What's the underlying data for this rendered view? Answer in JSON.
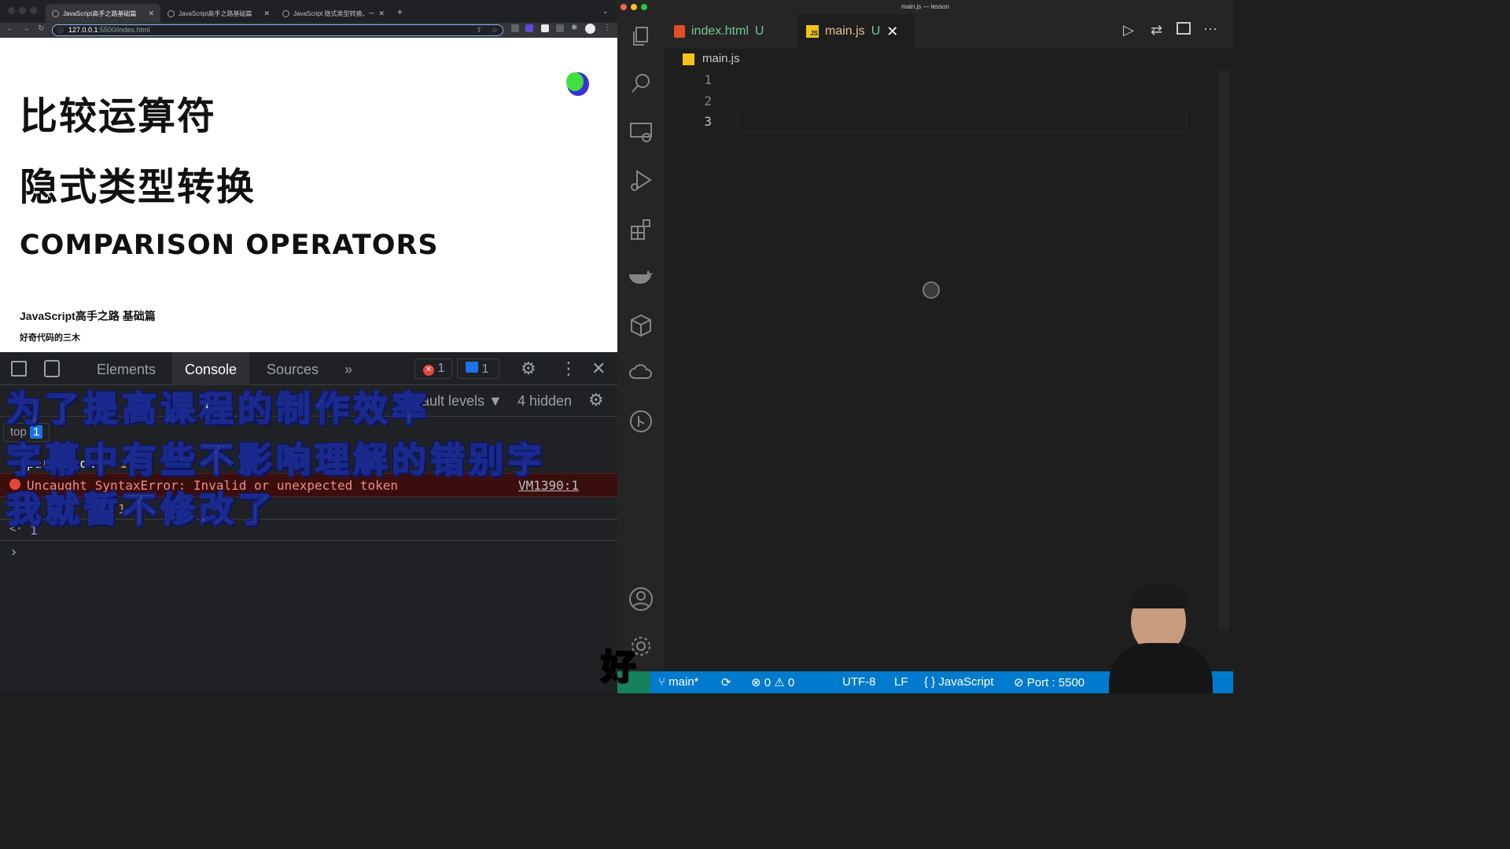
{
  "browser": {
    "tabs": [
      {
        "title": "JavaScript高手之路基础篇",
        "active": true
      },
      {
        "title": "JavaScript高手之路基础篇",
        "active": false
      },
      {
        "title": "JavaScript 隐式类型转换、一篇",
        "active": false
      }
    ],
    "new_tab": "+",
    "url_host": "127.0.0.1",
    "url_path": ":5500/index.html"
  },
  "slide": {
    "title_1": "比较运算符",
    "title_2": "隐式类型转换",
    "title_en": "COMPARISON OPERATORS",
    "course": "JavaScript高手之路 基础篇",
    "author": "好奇代码的三木"
  },
  "devtools": {
    "tabs": [
      "Elements",
      "Console",
      "Sources"
    ],
    "more": "»",
    "error_count": "1",
    "message_count": "1",
    "levels": "Default levels ▼",
    "hidden": "4 hidden",
    "context": "top",
    "context_count": "1",
    "log_1_text": "parseFloat",
    "log_1_value": "1",
    "error_text": "Uncaught SyntaxError: Invalid or unexpected token",
    "error_source": "VM1390:1",
    "log_2_value": "1",
    "result_arrow": "<·",
    "result_value": "1",
    "prompt": "›"
  },
  "subtitles": [
    "为了提高课程的制作效率",
    "字幕中有些不影响理解的错别字",
    "我就暂不修改了"
  ],
  "caption_char": "好",
  "vscode": {
    "window_title": "main.js — lesson",
    "tabs": [
      {
        "name": "index.html",
        "status": "U",
        "icon": "html-file-icon",
        "active": false
      },
      {
        "name": "main.js",
        "status": "U",
        "icon": "js-file-icon",
        "active": true
      }
    ],
    "breadcrumb": "main.js",
    "line_numbers": [
      "1",
      "2",
      "3"
    ],
    "status": {
      "branch": "main*",
      "errors": "0",
      "warnings": "0",
      "encoding": "UTF-8",
      "eol": "LF",
      "language": "JavaScript",
      "port": "Port : 5500"
    }
  },
  "colors": {
    "accent": "#007acc",
    "error_bg": "#3b0e0e",
    "subtitle_fill": "#ffe58a",
    "subtitle_stroke": "#1a2a8c",
    "js_tab_text": "#e2c08d",
    "html_tab_text": "#73c991"
  }
}
